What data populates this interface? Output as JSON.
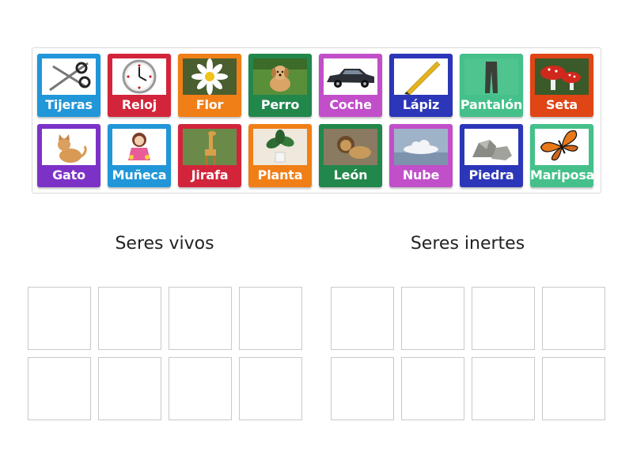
{
  "cards": [
    {
      "label": "Tijeras",
      "color": "#2196d8",
      "icon": "scissors-icon"
    },
    {
      "label": "Reloj",
      "color": "#d2253b",
      "icon": "clock-icon"
    },
    {
      "label": "Flor",
      "color": "#f07f17",
      "icon": "flower-icon"
    },
    {
      "label": "Perro",
      "color": "#21874b",
      "icon": "dog-icon"
    },
    {
      "label": "Coche",
      "color": "#c14fc9",
      "icon": "car-icon"
    },
    {
      "label": "Lápiz",
      "color": "#2c36b8",
      "icon": "pencil-icon"
    },
    {
      "label": "Pantalón",
      "color": "#45c08a",
      "icon": "trousers-icon"
    },
    {
      "label": "Seta",
      "color": "#df4515",
      "icon": "mushroom-icon"
    },
    {
      "label": "Gato",
      "color": "#7d32c7",
      "icon": "cat-icon"
    },
    {
      "label": "Muñeca",
      "color": "#2196d8",
      "icon": "doll-icon"
    },
    {
      "label": "Jirafa",
      "color": "#d2253b",
      "icon": "giraffe-icon"
    },
    {
      "label": "Planta",
      "color": "#f07f17",
      "icon": "plant-icon"
    },
    {
      "label": "León",
      "color": "#21874b",
      "icon": "lion-icon"
    },
    {
      "label": "Nube",
      "color": "#c14fc9",
      "icon": "cloud-icon"
    },
    {
      "label": "Piedra",
      "color": "#2c36b8",
      "icon": "stone-icon"
    },
    {
      "label": "Mariposa",
      "color": "#45c08a",
      "icon": "butterfly-icon"
    }
  ],
  "groups": [
    {
      "title": "Seres vivos"
    },
    {
      "title": "Seres inertes"
    }
  ]
}
